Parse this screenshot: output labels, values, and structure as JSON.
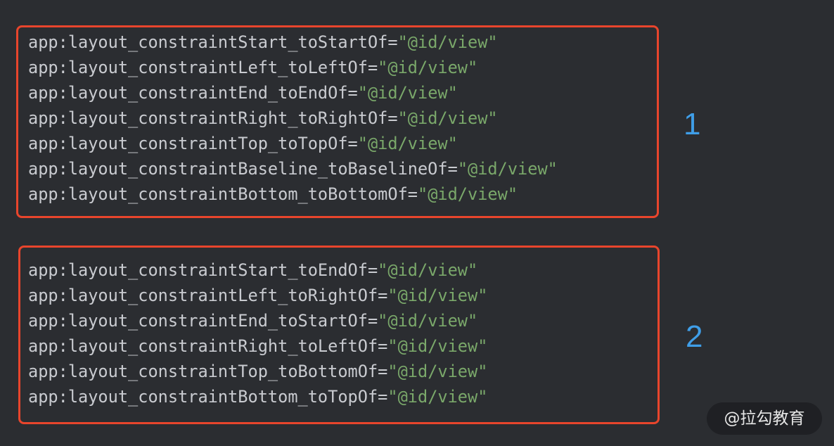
{
  "groups": [
    {
      "number": "1",
      "lines": [
        {
          "attr": "app:layout_constraintStart_toStartOf=",
          "value": "\"@id/view\""
        },
        {
          "attr": "app:layout_constraintLeft_toLeftOf=",
          "value": "\"@id/view\""
        },
        {
          "attr": "app:layout_constraintEnd_toEndOf=",
          "value": "\"@id/view\""
        },
        {
          "attr": "app:layout_constraintRight_toRightOf=",
          "value": "\"@id/view\""
        },
        {
          "attr": "app:layout_constraintTop_toTopOf=",
          "value": "\"@id/view\""
        },
        {
          "attr": "app:layout_constraintBaseline_toBaselineOf=",
          "value": "\"@id/view\""
        },
        {
          "attr": "app:layout_constraintBottom_toBottomOf=",
          "value": "\"@id/view\""
        }
      ]
    },
    {
      "number": "2",
      "lines": [
        {
          "attr": "app:layout_constraintStart_toEndOf=",
          "value": "\"@id/view\""
        },
        {
          "attr": "app:layout_constraintLeft_toRightOf=",
          "value": "\"@id/view\""
        },
        {
          "attr": "app:layout_constraintEnd_toStartOf=",
          "value": "\"@id/view\""
        },
        {
          "attr": "app:layout_constraintRight_toLeftOf=",
          "value": "\"@id/view\""
        },
        {
          "attr": "app:layout_constraintTop_toBottomOf=",
          "value": "\"@id/view\""
        },
        {
          "attr": "app:layout_constraintBottom_toTopOf=",
          "value": "\"@id/view\""
        }
      ]
    }
  ],
  "watermark": "@拉勾教育",
  "colors": {
    "background": "#2b2d31",
    "box_border": "#e8452c",
    "code_text": "#c9cbd0",
    "string_value": "#7aa86a",
    "group_number": "#3f9ee8"
  }
}
